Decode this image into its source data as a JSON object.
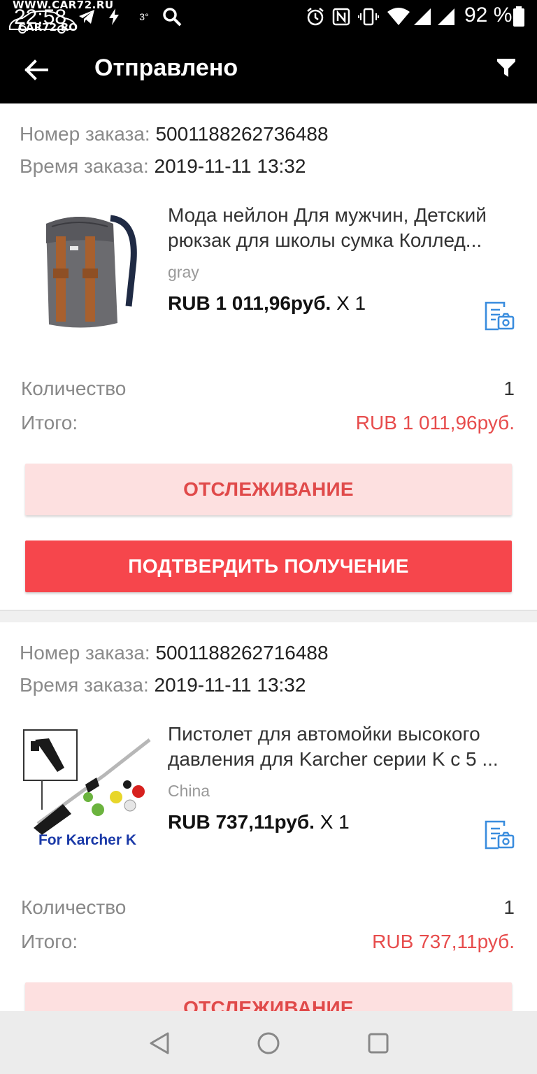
{
  "status_bar": {
    "watermark_url": "WWW.CAR72.RU",
    "time": "22:58",
    "watermark_site": "CAR72.RO",
    "temperature": "3°",
    "battery": "92 %",
    "icons": [
      "telegram-icon",
      "flash-icon",
      "search-icon",
      "alarm-icon",
      "nfc-icon",
      "vibrate-icon",
      "wifi-icon",
      "signal-icon",
      "signal-icon",
      "battery-icon"
    ]
  },
  "app_bar": {
    "title": "Отправлено",
    "back_icon": "arrow-left-icon",
    "filter_icon": "filter-icon"
  },
  "orders": [
    {
      "order_number_label": "Номер заказа:",
      "order_number": "5001188262736488",
      "order_time_label": "Время заказа:",
      "order_time": "2019-11-11 13:32",
      "product_title": "Мода нейлон Для мужчин, Детский рюкзак для школы сумка Коллед...",
      "product_sku": "gray",
      "product_price": "RUB 1 011,96руб.",
      "product_qty": "X 1",
      "quantity_label": "Количество",
      "quantity_value": "1",
      "total_label": "Итого:",
      "total_value": "RUB 1 011,96руб.",
      "track_label": "ОТСЛЕЖИВАНИЕ",
      "confirm_label": "ПОДТВЕРДИТЬ ПОЛУЧЕНИЕ"
    },
    {
      "order_number_label": "Номер заказа:",
      "order_number": "5001188262716488",
      "order_time_label": "Время заказа:",
      "order_time": "2019-11-11 13:32",
      "product_title": "Пистолет для автомойки высокого давления для Karcher серии K с 5 ...",
      "product_sku": "China",
      "product_price": "RUB 737,11руб.",
      "product_qty": "X 1",
      "image_caption": "For Karcher K",
      "quantity_label": "Количество",
      "quantity_value": "1",
      "total_label": "Итого:",
      "total_value": "RUB 737,11руб.",
      "track_label": "ОТСЛЕЖИВАНИЕ"
    }
  ],
  "nav_bar": {
    "icons": [
      "back-triangle-icon",
      "home-circle-icon",
      "recents-square-icon"
    ]
  },
  "colors": {
    "accent_red": "#f6464c",
    "price_red": "#e74c4c",
    "track_bg": "#fde0e0",
    "receipt_blue": "#3a8dde"
  }
}
